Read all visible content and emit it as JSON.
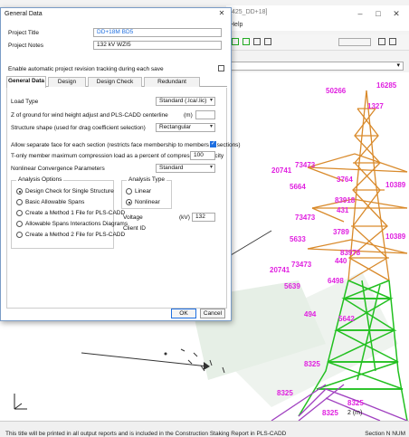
{
  "app": {
    "title_fragment": "425_DD+18]",
    "menu_fragment": "Help",
    "select_value": "",
    "status_text": "This title will be printed in all output reports and is included in the Construction Staking Report in PLS-CADD",
    "status_right": "Section  N  NUM",
    "scale_label": "2 (m)"
  },
  "tower_labels": [
    "16285",
    "50266",
    "1327",
    "20741",
    "73473",
    "5664",
    "3764",
    "10389",
    "83918",
    "431",
    "73473",
    "3789",
    "5633",
    "10389",
    "83978",
    "20741",
    "73473",
    "5639",
    "6498",
    "440",
    "5642",
    "494",
    "8325",
    "8325",
    "8325",
    "8325"
  ],
  "dialog": {
    "title": "General Data",
    "project_title_label": "Project Title",
    "project_title_value": "DD+18M BD5",
    "project_notes_label": "Project Notes",
    "project_notes_value": "132 kV WZI5",
    "auto_tracking_label": "Enable automatic project revision tracking during each save",
    "tabs": [
      "General Data",
      "Design Checks",
      "Design Check Options",
      "Redundant Members"
    ],
    "load_type_label": "Load Type",
    "load_type_value": "Standard (.lca/.lic)",
    "z_ground_label": "Z of ground for wind height adjust and PLS-CADD centerline",
    "z_ground_unit": "(m)",
    "z_ground_value": "",
    "structure_shape_label": "Structure shape (used for drag coefficient selection)",
    "structure_shape_value": "Rectangular",
    "separate_face_label": "Allow separate face for each section (restricts face membership to members in sections)",
    "tension_only_label": "T-only member maximum compression load as a percent of compression capacity",
    "tension_only_value": "100",
    "nonlinear_label": "Nonlinear Convergence Parameters",
    "nonlinear_value": "Standard",
    "analysis_options_title": "Analysis Options",
    "analysis_options": [
      "Design Check for Single Structure",
      "Basic Allowable Spans",
      "Create a Method 1 File for PLS-CADD",
      "Allowable Spans Interactions Diagrams",
      "Create a Method 2 File for PLS-CADD"
    ],
    "analysis_type_title": "Analysis Type",
    "analysis_types": [
      "Linear",
      "Nonlinear"
    ],
    "voltage_label": "Voltage",
    "voltage_unit": "(kV)",
    "voltage_value": "132",
    "client_id_label": "Client ID",
    "client_id_value": "",
    "ok_label": "OK",
    "cancel_label": "Cancel"
  },
  "colors": {
    "accent": "#1f6fe0",
    "label_magenta": "#e020e0",
    "tower_orange": "#d98a2b",
    "tower_green": "#22c020",
    "tower_purple": "#a040c0"
  }
}
